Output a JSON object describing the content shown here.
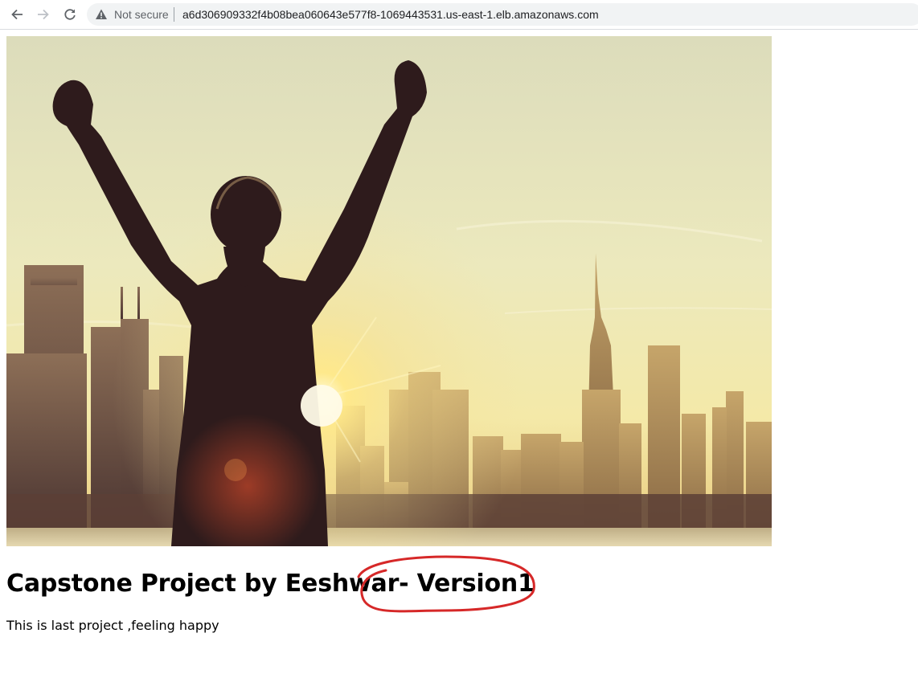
{
  "browser": {
    "security_label": "Not secure",
    "url": "a6d306909332f4b08bea060643e577f8-1069443531.us-east-1.elb.amazonaws.com",
    "icons": [
      "back-arrow-icon",
      "forward-arrow-icon",
      "reload-icon",
      "warning-icon"
    ]
  },
  "page": {
    "title": "Capstone Project by Eeshwar- Version1",
    "subtitle": "This is last project ,feeling happy"
  },
  "annotation": {
    "color": "#d62828"
  }
}
